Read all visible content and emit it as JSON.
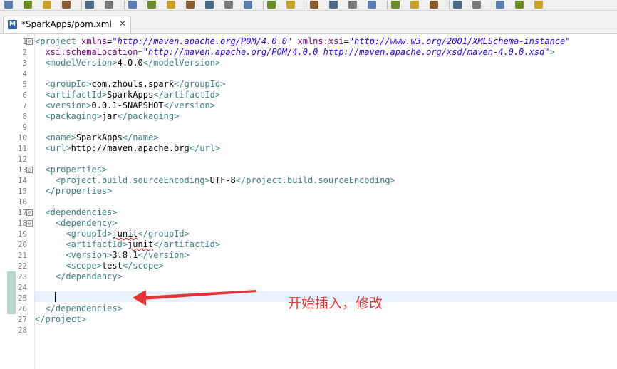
{
  "toolbar": {
    "icons": [
      "save-icon",
      "save-all-icon",
      "clean-icon",
      "build-icon",
      "terminal-icon",
      "search-icon",
      "resume-icon",
      "suspend-icon",
      "terminate-icon",
      "disconnect-icon",
      "step-into-icon",
      "step-over-icon",
      "step-return-icon",
      "open-type-icon",
      "task-icon",
      "debug-icon",
      "run-icon",
      "external-tools-icon",
      "server-icon",
      "new-folder-icon",
      "open-folder-icon",
      "edit-icon",
      "globe-icon",
      "run-last-icon",
      "lightbulb-icon",
      "up-arrow-icon",
      "back-icon"
    ]
  },
  "editor": {
    "tab_title": "*SparkApps/pom.xml",
    "tab_icon_letter": "M",
    "tab_close": "✕",
    "fold_glyph": "⊖",
    "lines": [
      {
        "n": "1",
        "fold": true,
        "tokens": [
          {
            "c": "tg",
            "t": "<project "
          },
          {
            "c": "at",
            "t": "xmlns"
          },
          {
            "c": "tx",
            "t": "="
          },
          {
            "c": "av",
            "t": "\"http://maven.apache.org/POM/4.0.0\""
          },
          {
            "c": "tx",
            "t": " "
          },
          {
            "c": "at",
            "t": "xmlns:xsi"
          },
          {
            "c": "tx",
            "t": "="
          },
          {
            "c": "av",
            "t": "\"http://www.w3.org/2001/XMLSchema-instance\""
          }
        ]
      },
      {
        "n": "2",
        "tokens": [
          {
            "c": "tx",
            "t": "  "
          },
          {
            "c": "at",
            "t": "xsi:schemaLocation"
          },
          {
            "c": "tx",
            "t": "="
          },
          {
            "c": "av",
            "t": "\"http://maven.apache.org/POM/4.0.0 http://maven.apache.org/xsd/maven-4.0.0.xsd\""
          },
          {
            "c": "tg",
            "t": ">"
          }
        ]
      },
      {
        "n": "3",
        "tokens": [
          {
            "c": "tx",
            "t": "  "
          },
          {
            "c": "tg",
            "t": "<modelVersion>"
          },
          {
            "c": "tx",
            "t": "4.0.0"
          },
          {
            "c": "tg",
            "t": "</modelVersion>"
          }
        ]
      },
      {
        "n": "4",
        "tokens": []
      },
      {
        "n": "5",
        "tokens": [
          {
            "c": "tx",
            "t": "  "
          },
          {
            "c": "tg",
            "t": "<groupId>"
          },
          {
            "c": "tx",
            "t": "com.zhouls.spark"
          },
          {
            "c": "tg",
            "t": "</groupId>"
          }
        ]
      },
      {
        "n": "6",
        "tokens": [
          {
            "c": "tx",
            "t": "  "
          },
          {
            "c": "tg",
            "t": "<artifactId>"
          },
          {
            "c": "tx",
            "t": "SparkApps"
          },
          {
            "c": "tg",
            "t": "</artifactId>"
          }
        ]
      },
      {
        "n": "7",
        "tokens": [
          {
            "c": "tx",
            "t": "  "
          },
          {
            "c": "tg",
            "t": "<version>"
          },
          {
            "c": "tx",
            "t": "0.0.1-SNAPSHOT"
          },
          {
            "c": "tg",
            "t": "</version>"
          }
        ]
      },
      {
        "n": "8",
        "tokens": [
          {
            "c": "tx",
            "t": "  "
          },
          {
            "c": "tg",
            "t": "<packaging>"
          },
          {
            "c": "tx",
            "t": "jar"
          },
          {
            "c": "tg",
            "t": "</packaging>"
          }
        ]
      },
      {
        "n": "9",
        "tokens": []
      },
      {
        "n": "10",
        "tokens": [
          {
            "c": "tx",
            "t": "  "
          },
          {
            "c": "tg",
            "t": "<name>"
          },
          {
            "c": "tx",
            "t": "SparkApps"
          },
          {
            "c": "tg",
            "t": "</name>"
          }
        ]
      },
      {
        "n": "11",
        "tokens": [
          {
            "c": "tx",
            "t": "  "
          },
          {
            "c": "tg",
            "t": "<url>"
          },
          {
            "c": "tx",
            "t": "http://maven.apache.org"
          },
          {
            "c": "tg",
            "t": "</url>"
          }
        ]
      },
      {
        "n": "12",
        "tokens": []
      },
      {
        "n": "13",
        "fold": true,
        "tokens": [
          {
            "c": "tx",
            "t": "  "
          },
          {
            "c": "tg",
            "t": "<properties>"
          }
        ]
      },
      {
        "n": "14",
        "tokens": [
          {
            "c": "tx",
            "t": "    "
          },
          {
            "c": "tg",
            "t": "<project.build.sourceEncoding>"
          },
          {
            "c": "tx",
            "t": "UTF-8"
          },
          {
            "c": "tg",
            "t": "</project.build.sourceEncoding>"
          }
        ]
      },
      {
        "n": "15",
        "tokens": [
          {
            "c": "tx",
            "t": "  "
          },
          {
            "c": "tg",
            "t": "</properties>"
          }
        ]
      },
      {
        "n": "16",
        "tokens": []
      },
      {
        "n": "17",
        "fold": true,
        "tokens": [
          {
            "c": "tx",
            "t": "  "
          },
          {
            "c": "tg",
            "t": "<dependencies>"
          }
        ]
      },
      {
        "n": "18",
        "fold": true,
        "tokens": [
          {
            "c": "tx",
            "t": "    "
          },
          {
            "c": "tg",
            "t": "<dependency>"
          }
        ]
      },
      {
        "n": "19",
        "tokens": [
          {
            "c": "tx",
            "t": "      "
          },
          {
            "c": "tg",
            "t": "<groupId>"
          },
          {
            "c": "tx squig",
            "t": "junit"
          },
          {
            "c": "tg",
            "t": "</groupId>"
          }
        ]
      },
      {
        "n": "20",
        "tokens": [
          {
            "c": "tx",
            "t": "      "
          },
          {
            "c": "tg",
            "t": "<artifactId>"
          },
          {
            "c": "tx squig",
            "t": "junit"
          },
          {
            "c": "tg",
            "t": "</artifactId>"
          }
        ]
      },
      {
        "n": "21",
        "tokens": [
          {
            "c": "tx",
            "t": "      "
          },
          {
            "c": "tg",
            "t": "<version>"
          },
          {
            "c": "tx",
            "t": "3.8.1"
          },
          {
            "c": "tg",
            "t": "</version>"
          }
        ]
      },
      {
        "n": "22",
        "tokens": [
          {
            "c": "tx",
            "t": "      "
          },
          {
            "c": "tg",
            "t": "<scope>"
          },
          {
            "c": "tx",
            "t": "test"
          },
          {
            "c": "tg",
            "t": "</scope>"
          }
        ]
      },
      {
        "n": "23",
        "changed": true,
        "tokens": [
          {
            "c": "tx",
            "t": "    "
          },
          {
            "c": "tg",
            "t": "</dependency>"
          }
        ]
      },
      {
        "n": "24",
        "changed": true,
        "tokens": []
      },
      {
        "n": "25",
        "changed": true,
        "current": true,
        "tokens": []
      },
      {
        "n": "26",
        "changed": true,
        "tokens": [
          {
            "c": "tx",
            "t": "  "
          },
          {
            "c": "tg",
            "t": "</dependencies>"
          }
        ]
      },
      {
        "n": "27",
        "tokens": [
          {
            "c": "tg",
            "t": "</project>"
          }
        ]
      },
      {
        "n": "28",
        "tokens": []
      }
    ]
  },
  "annotation": {
    "text": "开始插入，修改",
    "color": "#e53333"
  }
}
